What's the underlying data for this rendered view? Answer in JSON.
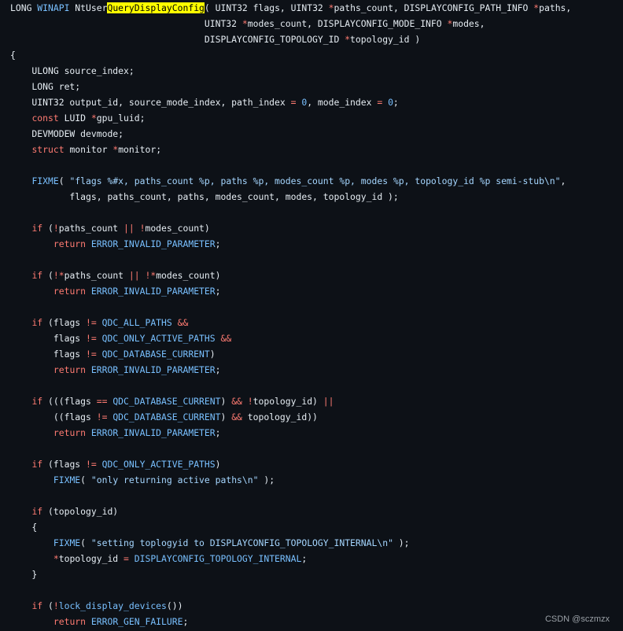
{
  "colors": {
    "background": "#0d1117",
    "plain": "#e6edf3",
    "keyword": "#ff7b72",
    "macro": "#79c0ff",
    "string": "#a5d6ff",
    "highlight_bg": "#ffff00"
  },
  "watermark": "CSDN @sczmzx",
  "lines": [
    [
      [
        "plain",
        "LONG "
      ],
      [
        "macro",
        "WINAPI"
      ],
      [
        "plain",
        " NtUser"
      ],
      [
        "highlight",
        "QueryDisplayConfig"
      ],
      [
        "plain",
        "( UINT32 flags, UINT32 "
      ],
      [
        "op",
        "*"
      ],
      [
        "plain",
        "paths_count, DISPLAYCONFIG_PATH_INFO "
      ],
      [
        "op",
        "*"
      ],
      [
        "plain",
        "paths,"
      ]
    ],
    [
      [
        "plain",
        "                                    UINT32 "
      ],
      [
        "op",
        "*"
      ],
      [
        "plain",
        "modes_count, DISPLAYCONFIG_MODE_INFO "
      ],
      [
        "op",
        "*"
      ],
      [
        "plain",
        "modes,"
      ]
    ],
    [
      [
        "plain",
        "                                    DISPLAYCONFIG_TOPOLOGY_ID "
      ],
      [
        "op",
        "*"
      ],
      [
        "plain",
        "topology_id )"
      ]
    ],
    [
      [
        "plain",
        "{"
      ]
    ],
    [
      [
        "plain",
        "    ULONG source_index;"
      ]
    ],
    [
      [
        "plain",
        "    LONG ret;"
      ]
    ],
    [
      [
        "plain",
        "    UINT32 output_id, source_mode_index, path_index "
      ],
      [
        "op",
        "="
      ],
      [
        "plain",
        " "
      ],
      [
        "number",
        "0"
      ],
      [
        "plain",
        ", mode_index "
      ],
      [
        "op",
        "="
      ],
      [
        "plain",
        " "
      ],
      [
        "number",
        "0"
      ],
      [
        "plain",
        ";"
      ]
    ],
    [
      [
        "plain",
        "    "
      ],
      [
        "keyword",
        "const"
      ],
      [
        "plain",
        " LUID "
      ],
      [
        "op",
        "*"
      ],
      [
        "plain",
        "gpu_luid;"
      ]
    ],
    [
      [
        "plain",
        "    DEVMODEW devmode;"
      ]
    ],
    [
      [
        "plain",
        "    "
      ],
      [
        "keyword",
        "struct"
      ],
      [
        "plain",
        " monitor "
      ],
      [
        "op",
        "*"
      ],
      [
        "plain",
        "monitor;"
      ]
    ],
    [
      [
        "plain",
        ""
      ]
    ],
    [
      [
        "plain",
        "    "
      ],
      [
        "macro",
        "FIXME"
      ],
      [
        "plain",
        "( "
      ],
      [
        "string",
        "\"flags %#x, paths_count %p, paths %p, modes_count %p, modes %p, topology_id %p semi-stub\\n\""
      ],
      [
        "plain",
        ","
      ]
    ],
    [
      [
        "plain",
        "           flags, paths_count, paths, modes_count, modes, topology_id );"
      ]
    ],
    [
      [
        "plain",
        ""
      ]
    ],
    [
      [
        "plain",
        "    "
      ],
      [
        "keyword",
        "if"
      ],
      [
        "plain",
        " ("
      ],
      [
        "op",
        "!"
      ],
      [
        "plain",
        "paths_count "
      ],
      [
        "op",
        "||"
      ],
      [
        "plain",
        " "
      ],
      [
        "op",
        "!"
      ],
      [
        "plain",
        "modes_count)"
      ]
    ],
    [
      [
        "plain",
        "        "
      ],
      [
        "keyword",
        "return"
      ],
      [
        "plain",
        " "
      ],
      [
        "macro",
        "ERROR_INVALID_PARAMETER"
      ],
      [
        "plain",
        ";"
      ]
    ],
    [
      [
        "plain",
        ""
      ]
    ],
    [
      [
        "plain",
        "    "
      ],
      [
        "keyword",
        "if"
      ],
      [
        "plain",
        " ("
      ],
      [
        "op",
        "!*"
      ],
      [
        "plain",
        "paths_count "
      ],
      [
        "op",
        "||"
      ],
      [
        "plain",
        " "
      ],
      [
        "op",
        "!*"
      ],
      [
        "plain",
        "modes_count)"
      ]
    ],
    [
      [
        "plain",
        "        "
      ],
      [
        "keyword",
        "return"
      ],
      [
        "plain",
        " "
      ],
      [
        "macro",
        "ERROR_INVALID_PARAMETER"
      ],
      [
        "plain",
        ";"
      ]
    ],
    [
      [
        "plain",
        ""
      ]
    ],
    [
      [
        "plain",
        "    "
      ],
      [
        "keyword",
        "if"
      ],
      [
        "plain",
        " (flags "
      ],
      [
        "op",
        "!="
      ],
      [
        "plain",
        " "
      ],
      [
        "macro",
        "QDC_ALL_PATHS"
      ],
      [
        "plain",
        " "
      ],
      [
        "op",
        "&&"
      ]
    ],
    [
      [
        "plain",
        "        flags "
      ],
      [
        "op",
        "!="
      ],
      [
        "plain",
        " "
      ],
      [
        "macro",
        "QDC_ONLY_ACTIVE_PATHS"
      ],
      [
        "plain",
        " "
      ],
      [
        "op",
        "&&"
      ]
    ],
    [
      [
        "plain",
        "        flags "
      ],
      [
        "op",
        "!="
      ],
      [
        "plain",
        " "
      ],
      [
        "macro",
        "QDC_DATABASE_CURRENT"
      ],
      [
        "plain",
        ")"
      ]
    ],
    [
      [
        "plain",
        "        "
      ],
      [
        "keyword",
        "return"
      ],
      [
        "plain",
        " "
      ],
      [
        "macro",
        "ERROR_INVALID_PARAMETER"
      ],
      [
        "plain",
        ";"
      ]
    ],
    [
      [
        "plain",
        ""
      ]
    ],
    [
      [
        "plain",
        "    "
      ],
      [
        "keyword",
        "if"
      ],
      [
        "plain",
        " (((flags "
      ],
      [
        "op",
        "=="
      ],
      [
        "plain",
        " "
      ],
      [
        "macro",
        "QDC_DATABASE_CURRENT"
      ],
      [
        "plain",
        ") "
      ],
      [
        "op",
        "&&"
      ],
      [
        "plain",
        " "
      ],
      [
        "op",
        "!"
      ],
      [
        "plain",
        "topology_id) "
      ],
      [
        "op",
        "||"
      ]
    ],
    [
      [
        "plain",
        "        ((flags "
      ],
      [
        "op",
        "!="
      ],
      [
        "plain",
        " "
      ],
      [
        "macro",
        "QDC_DATABASE_CURRENT"
      ],
      [
        "plain",
        ") "
      ],
      [
        "op",
        "&&"
      ],
      [
        "plain",
        " topology_id))"
      ]
    ],
    [
      [
        "plain",
        "        "
      ],
      [
        "keyword",
        "return"
      ],
      [
        "plain",
        " "
      ],
      [
        "macro",
        "ERROR_INVALID_PARAMETER"
      ],
      [
        "plain",
        ";"
      ]
    ],
    [
      [
        "plain",
        ""
      ]
    ],
    [
      [
        "plain",
        "    "
      ],
      [
        "keyword",
        "if"
      ],
      [
        "plain",
        " (flags "
      ],
      [
        "op",
        "!="
      ],
      [
        "plain",
        " "
      ],
      [
        "macro",
        "QDC_ONLY_ACTIVE_PATHS"
      ],
      [
        "plain",
        ")"
      ]
    ],
    [
      [
        "plain",
        "        "
      ],
      [
        "macro",
        "FIXME"
      ],
      [
        "plain",
        "( "
      ],
      [
        "string",
        "\"only returning active paths\\n\""
      ],
      [
        "plain",
        " );"
      ]
    ],
    [
      [
        "plain",
        ""
      ]
    ],
    [
      [
        "plain",
        "    "
      ],
      [
        "keyword",
        "if"
      ],
      [
        "plain",
        " (topology_id)"
      ]
    ],
    [
      [
        "plain",
        "    {"
      ]
    ],
    [
      [
        "plain",
        "        "
      ],
      [
        "macro",
        "FIXME"
      ],
      [
        "plain",
        "( "
      ],
      [
        "string",
        "\"setting toplogyid to DISPLAYCONFIG_TOPOLOGY_INTERNAL\\n\""
      ],
      [
        "plain",
        " );"
      ]
    ],
    [
      [
        "plain",
        "        "
      ],
      [
        "op",
        "*"
      ],
      [
        "plain",
        "topology_id "
      ],
      [
        "op",
        "="
      ],
      [
        "plain",
        " "
      ],
      [
        "macro",
        "DISPLAYCONFIG_TOPOLOGY_INTERNAL"
      ],
      [
        "plain",
        ";"
      ]
    ],
    [
      [
        "plain",
        "    }"
      ]
    ],
    [
      [
        "plain",
        ""
      ]
    ],
    [
      [
        "plain",
        "    "
      ],
      [
        "keyword",
        "if"
      ],
      [
        "plain",
        " ("
      ],
      [
        "op",
        "!"
      ],
      [
        "macro",
        "lock_display_devices"
      ],
      [
        "plain",
        "())"
      ]
    ],
    [
      [
        "plain",
        "        "
      ],
      [
        "keyword",
        "return"
      ],
      [
        "plain",
        " "
      ],
      [
        "macro",
        "ERROR_GEN_FAILURE"
      ],
      [
        "plain",
        ";"
      ]
    ]
  ]
}
